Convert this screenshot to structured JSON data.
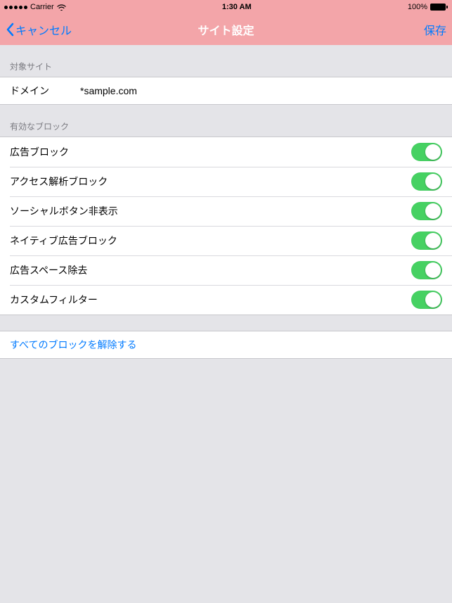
{
  "status_bar": {
    "carrier": "Carrier",
    "time": "1:30 AM",
    "battery_pct": "100%"
  },
  "nav": {
    "cancel": "キャンセル",
    "title": "サイト設定",
    "save": "保存"
  },
  "sections": {
    "target": {
      "header": "対象サイト",
      "domain_label": "ドメイン",
      "domain_value": "*sample.com"
    },
    "blocks": {
      "header": "有効なブロック",
      "items": [
        {
          "label": "広告ブロック",
          "on": true
        },
        {
          "label": "アクセス解析ブロック",
          "on": true
        },
        {
          "label": "ソーシャルボタン非表示",
          "on": true
        },
        {
          "label": "ネイティブ広告ブロック",
          "on": true
        },
        {
          "label": "広告スペース除去",
          "on": true
        },
        {
          "label": "カスタムフィルター",
          "on": true
        }
      ]
    },
    "action": {
      "remove_all": "すべてのブロックを解除する"
    }
  },
  "colors": {
    "nav_bg": "#f3a5a9",
    "link": "#007aff",
    "toggle_on": "#46d162",
    "page_bg": "#e4e4e8"
  }
}
